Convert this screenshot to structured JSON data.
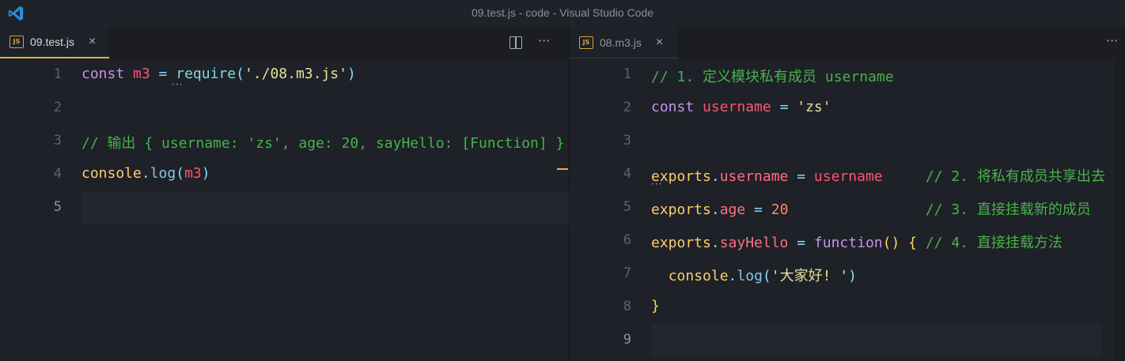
{
  "window": {
    "title": "09.test.js - code - Visual Studio Code"
  },
  "left_editor": {
    "tab": {
      "label": "09.test.js",
      "icon": "JS"
    },
    "lines": [
      {
        "n": "1",
        "tokens": [
          [
            "kw",
            "const "
          ],
          [
            "var",
            "m3"
          ],
          [
            "",
            ""
          ],
          [
            "pun",
            " = "
          ],
          [
            "fn",
            "require"
          ],
          [
            "pun",
            "("
          ],
          [
            "str",
            "'./08.m3.js'"
          ],
          [
            "pun",
            ")"
          ]
        ]
      },
      {
        "n": "2",
        "tokens": []
      },
      {
        "n": "3",
        "tokens": [
          [
            "cm",
            "// 输出 { username: 'zs', age: 20, sayHello: [Function] }"
          ]
        ]
      },
      {
        "n": "4",
        "tokens": [
          [
            "obj",
            "console"
          ],
          [
            "pun",
            "."
          ],
          [
            "meth",
            "log"
          ],
          [
            "pun",
            "("
          ],
          [
            "var",
            "m3"
          ],
          [
            "pun",
            ")"
          ]
        ]
      },
      {
        "n": "5",
        "tokens": []
      }
    ]
  },
  "right_editor": {
    "tab": {
      "label": "08.m3.js",
      "icon": "JS"
    },
    "lines": [
      {
        "n": "1",
        "tokens": [
          [
            "cm",
            "// 1. 定义模块私有成员 username"
          ]
        ]
      },
      {
        "n": "2",
        "tokens": [
          [
            "kw",
            "const "
          ],
          [
            "var",
            "username"
          ],
          [
            "pun",
            " = "
          ],
          [
            "str",
            "'zs'"
          ]
        ]
      },
      {
        "n": "3",
        "tokens": []
      },
      {
        "n": "4",
        "tokens": [
          [
            "obj",
            "exports"
          ],
          [
            "pun",
            "."
          ],
          [
            "prop",
            "username"
          ],
          [
            "pun",
            " = "
          ],
          [
            "var",
            "username"
          ],
          [
            "",
            "     "
          ],
          [
            "cm",
            "// 2. 将私有成员共享出去"
          ]
        ]
      },
      {
        "n": "5",
        "tokens": [
          [
            "obj",
            "exports"
          ],
          [
            "pun",
            "."
          ],
          [
            "prop",
            "age"
          ],
          [
            "pun",
            " = "
          ],
          [
            "num",
            "20"
          ],
          [
            "",
            "                "
          ],
          [
            "cm",
            "// 3. 直接挂载新的成员"
          ]
        ]
      },
      {
        "n": "6",
        "tokens": [
          [
            "obj",
            "exports"
          ],
          [
            "pun",
            "."
          ],
          [
            "prop",
            "sayHello"
          ],
          [
            "pun",
            " = "
          ],
          [
            "kw",
            "function"
          ],
          [
            "br",
            "()"
          ],
          [
            "pun",
            " "
          ],
          [
            "br",
            "{"
          ],
          [
            "pun",
            " "
          ],
          [
            "cm",
            "// 4. 直接挂载方法"
          ]
        ]
      },
      {
        "n": "7",
        "tokens": [
          [
            "",
            "  "
          ],
          [
            "obj",
            "console"
          ],
          [
            "pun",
            "."
          ],
          [
            "meth",
            "log"
          ],
          [
            "pun",
            "("
          ],
          [
            "str",
            "'大家好! '"
          ],
          [
            "pun",
            ")"
          ]
        ]
      },
      {
        "n": "8",
        "tokens": [
          [
            "br",
            "}"
          ]
        ]
      },
      {
        "n": "9",
        "tokens": []
      }
    ]
  },
  "icons": {
    "close": "×",
    "more": "···",
    "split": "split-editor-icon"
  },
  "colors": {
    "accent": "#e2b04a",
    "vscode_blue": "#2a8fd8"
  }
}
